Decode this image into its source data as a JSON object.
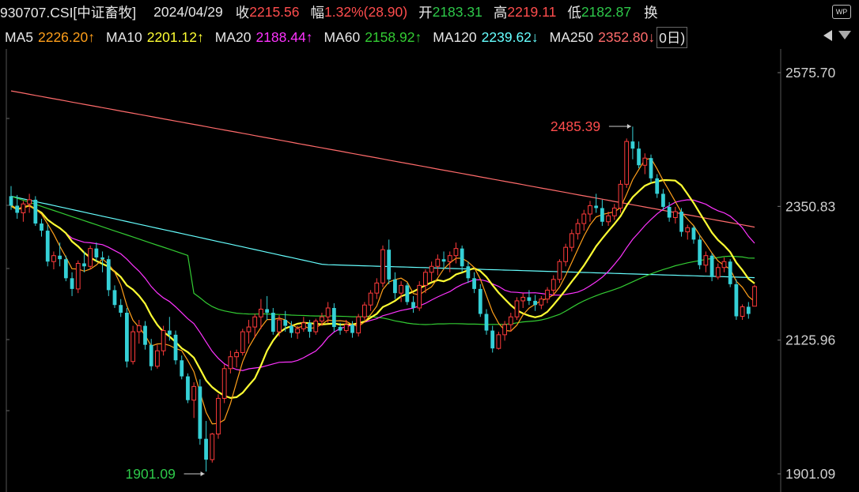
{
  "header": {
    "code": "930707.CSI[中证畜牧]",
    "date": "2024/04/29",
    "close_label": "收",
    "close_value": "2215.56",
    "change_label": "幅",
    "change_value": "1.32%(28.90)",
    "open_label": "开",
    "open_value": "2183.31",
    "high_label": "高",
    "high_value": "2219.11",
    "low_label": "低",
    "low_value": "2182.87",
    "switch_label": "换"
  },
  "ma_bar": {
    "items": [
      {
        "label": "MA5",
        "value": "2226.20↑",
        "color": "#ff9f1a"
      },
      {
        "label": "MA10",
        "value": "2201.12↑",
        "color": "#ffff33"
      },
      {
        "label": "MA20",
        "value": "2188.44↑",
        "color": "#ff33ff"
      },
      {
        "label": "MA60",
        "value": "2158.92↑",
        "color": "#33cc33"
      },
      {
        "label": "MA120",
        "value": "2239.62↓",
        "color": "#66ffff"
      },
      {
        "label": "MA250",
        "value": "2352.80↓",
        "color": "#ff6b6b"
      }
    ],
    "period_label": "0日)"
  },
  "toolbar": {
    "wp_label": "WP"
  },
  "chart_data": {
    "type": "candlestick",
    "y_ticks": [
      "2575.70",
      "2350.83",
      "2125.96",
      "1901.09"
    ],
    "ylim": [
      1901.09,
      2575.7
    ],
    "annotations": {
      "max": {
        "label": "2485.39",
        "value": 2485.39
      },
      "min": {
        "label": "1901.09",
        "value": 1901.09
      }
    },
    "colors": {
      "up": "#ff3b3b",
      "down": "#35d0d6",
      "ma5": "#ff9f1a",
      "ma10": "#ffff33",
      "ma20": "#ff33ff",
      "ma60": "#33cc33",
      "ma120": "#66ffff",
      "ma250": "#ff6b6b"
    },
    "ohlc": [
      [
        2368,
        2385,
        2345,
        2352
      ],
      [
        2352,
        2370,
        2330,
        2340
      ],
      [
        2340,
        2360,
        2325,
        2355
      ],
      [
        2355,
        2372,
        2340,
        2362
      ],
      [
        2362,
        2368,
        2318,
        2322
      ],
      [
        2322,
        2330,
        2300,
        2310
      ],
      [
        2310,
        2320,
        2250,
        2258
      ],
      [
        2258,
        2275,
        2245,
        2268
      ],
      [
        2268,
        2290,
        2250,
        2262
      ],
      [
        2262,
        2268,
        2225,
        2230
      ],
      [
        2230,
        2240,
        2200,
        2212
      ],
      [
        2212,
        2260,
        2205,
        2255
      ],
      [
        2255,
        2275,
        2240,
        2250
      ],
      [
        2250,
        2285,
        2245,
        2280
      ],
      [
        2280,
        2290,
        2258,
        2265
      ],
      [
        2265,
        2275,
        2240,
        2262
      ],
      [
        2262,
        2268,
        2200,
        2210
      ],
      [
        2210,
        2218,
        2180,
        2185
      ],
      [
        2185,
        2195,
        2165,
        2172
      ],
      [
        2172,
        2180,
        2080,
        2090
      ],
      [
        2090,
        2150,
        2085,
        2140
      ],
      [
        2140,
        2160,
        2120,
        2150
      ],
      [
        2150,
        2158,
        2110,
        2118
      ],
      [
        2118,
        2128,
        2075,
        2082
      ],
      [
        2082,
        2118,
        2078,
        2108
      ],
      [
        2108,
        2150,
        2100,
        2142
      ],
      [
        2142,
        2165,
        2125,
        2135
      ],
      [
        2135,
        2142,
        2085,
        2092
      ],
      [
        2092,
        2100,
        2060,
        2065
      ],
      [
        2065,
        2070,
        2020,
        2025
      ],
      [
        2025,
        2055,
        1995,
        2048
      ],
      [
        2048,
        2060,
        1950,
        1960
      ],
      [
        1960,
        1990,
        1905,
        1925
      ],
      [
        1925,
        1970,
        1920,
        1968
      ],
      [
        1968,
        2035,
        1960,
        2028
      ],
      [
        2028,
        2085,
        2020,
        2078
      ],
      [
        2078,
        2108,
        2070,
        2098
      ],
      [
        2098,
        2110,
        2080,
        2105
      ],
      [
        2105,
        2145,
        2100,
        2140
      ],
      [
        2140,
        2160,
        2120,
        2148
      ],
      [
        2148,
        2170,
        2130,
        2165
      ],
      [
        2165,
        2195,
        2145,
        2178
      ],
      [
        2178,
        2200,
        2160,
        2172
      ],
      [
        2172,
        2180,
        2135,
        2140
      ],
      [
        2140,
        2168,
        2132,
        2160
      ],
      [
        2160,
        2175,
        2140,
        2150
      ],
      [
        2150,
        2158,
        2130,
        2138
      ],
      [
        2138,
        2150,
        2128,
        2145
      ],
      [
        2145,
        2165,
        2140,
        2155
      ],
      [
        2155,
        2160,
        2130,
        2140
      ],
      [
        2140,
        2162,
        2135,
        2158
      ],
      [
        2158,
        2172,
        2150,
        2165
      ],
      [
        2165,
        2190,
        2155,
        2180
      ],
      [
        2180,
        2188,
        2140,
        2148
      ],
      [
        2148,
        2155,
        2135,
        2142
      ],
      [
        2142,
        2160,
        2138,
        2152
      ],
      [
        2152,
        2158,
        2130,
        2138
      ],
      [
        2138,
        2170,
        2132,
        2165
      ],
      [
        2165,
        2190,
        2160,
        2185
      ],
      [
        2185,
        2210,
        2175,
        2205
      ],
      [
        2205,
        2230,
        2195,
        2222
      ],
      [
        2222,
        2285,
        2215,
        2278
      ],
      [
        2278,
        2295,
        2220,
        2228
      ],
      [
        2228,
        2240,
        2195,
        2205
      ],
      [
        2205,
        2225,
        2190,
        2218
      ],
      [
        2218,
        2222,
        2185,
        2190
      ],
      [
        2190,
        2200,
        2172,
        2180
      ],
      [
        2180,
        2225,
        2175,
        2218
      ],
      [
        2218,
        2245,
        2205,
        2240
      ],
      [
        2240,
        2258,
        2225,
        2250
      ],
      [
        2250,
        2270,
        2235,
        2262
      ],
      [
        2262,
        2275,
        2245,
        2258
      ],
      [
        2258,
        2275,
        2240,
        2268
      ],
      [
        2268,
        2290,
        2255,
        2280
      ],
      [
        2280,
        2285,
        2240,
        2250
      ],
      [
        2250,
        2258,
        2222,
        2230
      ],
      [
        2230,
        2240,
        2205,
        2212
      ],
      [
        2212,
        2220,
        2165,
        2170
      ],
      [
        2170,
        2178,
        2135,
        2142
      ],
      [
        2142,
        2150,
        2105,
        2112
      ],
      [
        2112,
        2140,
        2110,
        2135
      ],
      [
        2135,
        2158,
        2125,
        2152
      ],
      [
        2152,
        2172,
        2140,
        2165
      ],
      [
        2165,
        2198,
        2160,
        2192
      ],
      [
        2192,
        2205,
        2180,
        2198
      ],
      [
        2198,
        2210,
        2185,
        2192
      ],
      [
        2192,
        2202,
        2175,
        2185
      ],
      [
        2185,
        2200,
        2178,
        2195
      ],
      [
        2195,
        2215,
        2188,
        2210
      ],
      [
        2210,
        2235,
        2200,
        2228
      ],
      [
        2228,
        2262,
        2222,
        2258
      ],
      [
        2258,
        2288,
        2250,
        2282
      ],
      [
        2282,
        2312,
        2275,
        2305
      ],
      [
        2305,
        2330,
        2295,
        2322
      ],
      [
        2322,
        2345,
        2310,
        2338
      ],
      [
        2338,
        2360,
        2325,
        2352
      ],
      [
        2352,
        2372,
        2340,
        2348
      ],
      [
        2348,
        2362,
        2318,
        2325
      ],
      [
        2325,
        2342,
        2318,
        2335
      ],
      [
        2335,
        2355,
        2328,
        2348
      ],
      [
        2348,
        2395,
        2340,
        2388
      ],
      [
        2388,
        2465,
        2382,
        2460
      ],
      [
        2460,
        2485,
        2430,
        2448
      ],
      [
        2448,
        2460,
        2415,
        2420
      ],
      [
        2420,
        2440,
        2405,
        2432
      ],
      [
        2432,
        2438,
        2390,
        2398
      ],
      [
        2398,
        2405,
        2365,
        2372
      ],
      [
        2372,
        2380,
        2345,
        2350
      ],
      [
        2350,
        2358,
        2325,
        2332
      ],
      [
        2332,
        2350,
        2322,
        2342
      ],
      [
        2342,
        2348,
        2300,
        2308
      ],
      [
        2308,
        2320,
        2295,
        2315
      ],
      [
        2315,
        2318,
        2288,
        2295
      ],
      [
        2295,
        2302,
        2245,
        2252
      ],
      [
        2252,
        2275,
        2240,
        2268
      ],
      [
        2268,
        2272,
        2225,
        2232
      ],
      [
        2232,
        2255,
        2228,
        2248
      ],
      [
        2248,
        2265,
        2240,
        2258
      ],
      [
        2258,
        2262,
        2215,
        2220
      ],
      [
        2220,
        2228,
        2160,
        2166
      ],
      [
        2166,
        2186,
        2160,
        2182
      ],
      [
        2182,
        2190,
        2162,
        2170
      ],
      [
        2183,
        2219,
        2183,
        2216
      ]
    ]
  }
}
